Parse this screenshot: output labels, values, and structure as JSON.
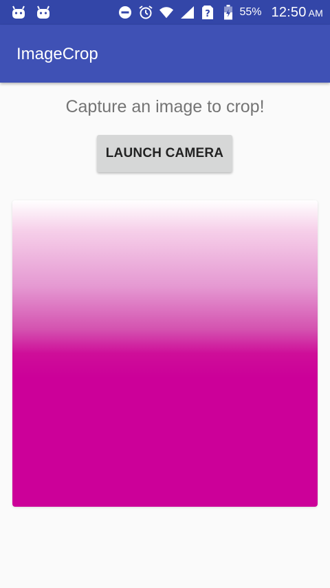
{
  "status_bar": {
    "battery_percent": "55%",
    "time": "12:50",
    "ampm": "AM",
    "icons": [
      "android-icon",
      "android-icon",
      "do-not-disturb-icon",
      "alarm-icon",
      "wifi-icon",
      "signal-icon",
      "no-sim-icon",
      "battery-icon"
    ]
  },
  "app_bar": {
    "title": "ImageCrop",
    "color": "#3f51b5"
  },
  "main": {
    "caption": "Capture an image to crop!",
    "launch_button_label": "LAUNCH CAMERA",
    "image_color": "#cc0099"
  }
}
